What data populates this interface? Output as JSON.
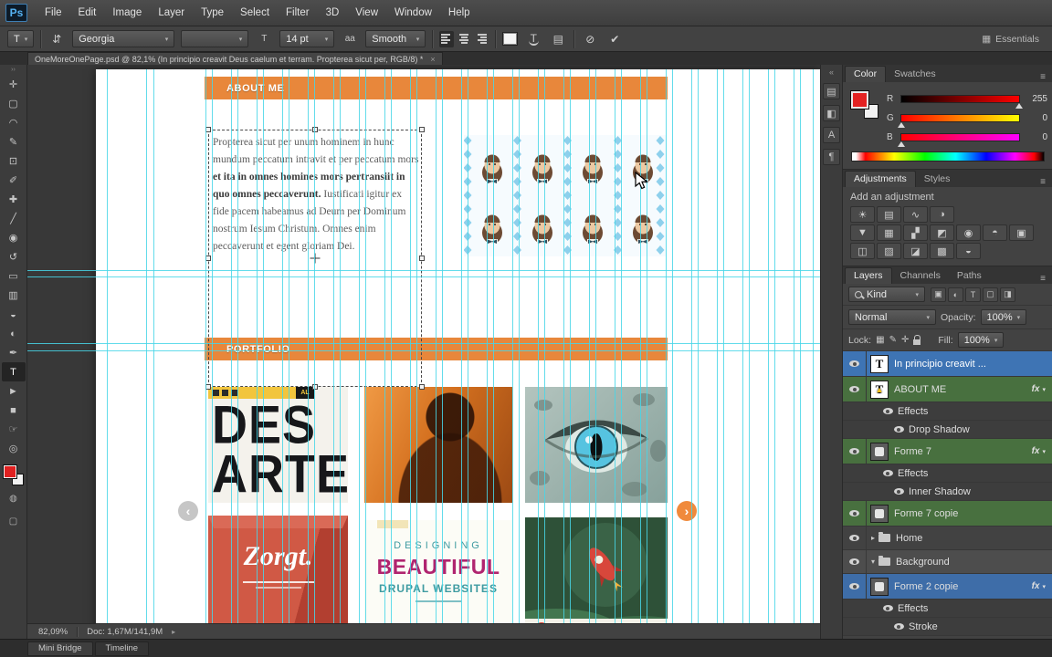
{
  "window": {
    "menubar": {
      "logo": "Ps",
      "items": [
        "File",
        "Edit",
        "Image",
        "Layer",
        "Type",
        "Select",
        "Filter",
        "3D",
        "View",
        "Window",
        "Help"
      ]
    },
    "options_bar": {
      "tool_badge": "T",
      "font_family": "Georgia",
      "font_style": "",
      "font_size": "14 pt",
      "anti_alias": "Smooth",
      "workspace": "Essentials"
    },
    "document_tab": {
      "title": "OneMoreOnePage.psd @ 82,1% (In principio creavit Deus caelum et terram. Propterea sicut per, RGB/8) *",
      "close": "×"
    },
    "status_bar": {
      "zoom": "82,09%",
      "doc_info": "Doc: 1,67M/141,9M",
      "flyout": "▸"
    },
    "bottom_tabs": [
      {
        "label": "Mini Bridge"
      },
      {
        "label": "Timeline"
      }
    ]
  },
  "icons": {
    "dropdown_arrow": "▾",
    "orientation": "⇵",
    "size_glyph": "T",
    "antialias_glyph": "aa",
    "cancel": "⊘",
    "commit": "✔",
    "workspace_grid": "▦",
    "panel_toggle": "▤",
    "panel_menu": "≡",
    "collapse_dock": "«",
    "strip_handle": "››",
    "prev_arrow": "‹",
    "next_arrow": "›"
  },
  "toolbar": {
    "tools": [
      {
        "name": "move-tool",
        "glyph": "✛"
      },
      {
        "name": "rectangular-marquee-tool",
        "glyph": "▢"
      },
      {
        "name": "lasso-tool",
        "glyph": "◠"
      },
      {
        "name": "quick-selection-tool",
        "glyph": "✎"
      },
      {
        "name": "crop-tool",
        "glyph": "⊡"
      },
      {
        "name": "eyedropper-tool",
        "glyph": "✐"
      },
      {
        "name": "healing-brush-tool",
        "glyph": "✚"
      },
      {
        "name": "brush-tool",
        "glyph": "╱"
      },
      {
        "name": "clone-stamp-tool",
        "glyph": "◉"
      },
      {
        "name": "history-brush-tool",
        "glyph": "↺"
      },
      {
        "name": "eraser-tool",
        "glyph": "▭"
      },
      {
        "name": "gradient-tool",
        "glyph": "▥"
      },
      {
        "name": "blur-tool",
        "glyph": "◒"
      },
      {
        "name": "dodge-tool",
        "glyph": "◐"
      },
      {
        "name": "pen-tool",
        "glyph": "✒"
      },
      {
        "name": "type-tool",
        "glyph": "T",
        "active": true
      },
      {
        "name": "path-selection-tool",
        "glyph": "►"
      },
      {
        "name": "rectangle-tool",
        "glyph": "■"
      },
      {
        "name": "hand-tool",
        "glyph": "☞"
      },
      {
        "name": "zoom-tool",
        "glyph": "◎"
      }
    ]
  },
  "canvas": {
    "sections": {
      "about": "ABOUT ME",
      "portfolio": "PORTFOLIO"
    },
    "text_block": {
      "lines": [
        [
          {
            "t": "Propterea sicut per unum hominem in hunc",
            "b": false
          }
        ],
        [
          {
            "t": "mundum peccatum intravit et per peccatum mors",
            "b": false
          }
        ],
        [
          {
            "t": "et ita in omnes homines mors pertransiit in",
            "b": true
          }
        ],
        [
          {
            "t": "quo omnes peccaverunt.",
            "b": true
          },
          {
            "t": " Iustificati igitur ex",
            "b": false
          }
        ],
        [
          {
            "t": "fide pacem habeamus ad Deum per Dominum",
            "b": false
          }
        ],
        [
          {
            "t": "nostrum Iesum Christum. Omnes enim",
            "b": false
          }
        ],
        [
          {
            "t": "peccaverunt et egent gloriam Dei.",
            "b": false
          }
        ]
      ]
    },
    "posters": {
      "des_art": {
        "badge": "AL",
        "line1": "DES",
        "line2": "ARTE"
      },
      "zorgt": {
        "title": "Zorgt."
      },
      "beautiful": {
        "line1": "DESIGNING",
        "line2": "BEAUTIFUL",
        "line3": "DRUPAL WEBSITES"
      }
    },
    "guides": {
      "vertical": [
        117,
        160,
        168,
        225,
        232,
        253,
        260,
        281,
        288,
        309,
        316,
        337,
        344,
        365,
        372,
        393,
        400,
        421,
        428,
        449,
        456,
        477,
        484,
        505,
        512,
        533,
        540,
        561,
        568,
        589,
        596,
        617,
        624,
        645,
        652,
        673,
        680,
        701,
        708,
        729,
        736,
        757,
        764,
        785,
        792,
        813,
        820,
        841,
        848,
        869,
        876,
        890
      ],
      "horizontal": [
        296,
        303,
        376,
        384
      ]
    }
  },
  "panels": {
    "color": {
      "tabs": [
        "Color",
        "Swatches"
      ],
      "sliders": [
        {
          "label": "R",
          "value": "255",
          "pos": 100,
          "from": "#000000",
          "to": "#ff0000"
        },
        {
          "label": "G",
          "value": "0",
          "pos": 0,
          "from": "#ff0000",
          "to": "#ffff00"
        },
        {
          "label": "B",
          "value": "0",
          "pos": 0,
          "from": "#ff0000",
          "to": "#ff00ff"
        }
      ]
    },
    "adjustments": {
      "tabs": [
        "Adjustments",
        "Styles"
      ],
      "title": "Add an adjustment",
      "rows": [
        [
          {
            "name": "brightness-contrast",
            "glyph": "☀"
          },
          {
            "name": "levels",
            "glyph": "▤"
          },
          {
            "name": "curves",
            "glyph": "∿"
          },
          {
            "name": "exposure",
            "glyph": "◑"
          }
        ],
        [
          {
            "name": "vibrance",
            "glyph": "▼"
          },
          {
            "name": "hue-saturation",
            "glyph": "▦"
          },
          {
            "name": "color-balance",
            "glyph": "▞"
          },
          {
            "name": "black-white",
            "glyph": "◩"
          },
          {
            "name": "photo-filter",
            "glyph": "◉"
          },
          {
            "name": "channel-mixer",
            "glyph": "◓"
          },
          {
            "name": "color-lookup",
            "glyph": "▣"
          }
        ],
        [
          {
            "name": "invert",
            "glyph": "◫"
          },
          {
            "name": "posterize",
            "glyph": "▨"
          },
          {
            "name": "threshold",
            "glyph": "◪"
          },
          {
            "name": "gradient-map",
            "glyph": "▩"
          },
          {
            "name": "selective-color",
            "glyph": "◒"
          }
        ]
      ]
    },
    "layers": {
      "tabs": [
        "Layers",
        "Channels",
        "Paths"
      ],
      "filter_label": "Kind",
      "filter_icons": [
        {
          "name": "pixel-layer-filter",
          "glyph": "▣"
        },
        {
          "name": "adjustment-layer-filter",
          "glyph": "◐"
        },
        {
          "name": "type-layer-filter",
          "glyph": "T"
        },
        {
          "name": "shape-layer-filter",
          "glyph": "▢"
        },
        {
          "name": "smart-object-filter",
          "glyph": "◨"
        }
      ],
      "blend_mode": "Normal",
      "opacity_label": "Opacity:",
      "opacity": "100%",
      "lock_label": "Lock:",
      "lock_icons": [
        {
          "name": "lock-transparency",
          "glyph": "▦"
        },
        {
          "name": "lock-pixels",
          "glyph": "✎"
        },
        {
          "name": "lock-position",
          "glyph": "✛"
        },
        {
          "name": "lock-all",
          "glyph": "padlock"
        }
      ],
      "fill_label": "Fill:",
      "fill": "100%",
      "fx_label": "fx",
      "rows": [
        {
          "kind": "layer",
          "thumb": "text",
          "name": "In principio creavit ...",
          "selected": true
        },
        {
          "kind": "layer",
          "thumb": "text",
          "name": "ABOUT ME",
          "color": "green",
          "warning": true,
          "fx": true
        },
        {
          "kind": "fxhead",
          "name": "Effects"
        },
        {
          "kind": "fxitem",
          "name": "Drop Shadow"
        },
        {
          "kind": "layer",
          "thumb": "shape",
          "name": "Forme 7",
          "color": "green",
          "fx": true
        },
        {
          "kind": "fxhead",
          "name": "Effects"
        },
        {
          "kind": "fxitem",
          "name": "Inner Shadow"
        },
        {
          "kind": "layer",
          "thumb": "shape",
          "name": "Forme 7 copie",
          "color": "green"
        },
        {
          "kind": "group",
          "name": "Home",
          "collapsed": true
        },
        {
          "kind": "group",
          "name": "Background",
          "collapsed": false,
          "color": "gray"
        },
        {
          "kind": "layer",
          "thumb": "shape",
          "name": "Forme 2 copie",
          "color": "blue",
          "fx": true
        },
        {
          "kind": "fxhead",
          "name": "Effects"
        },
        {
          "kind": "fxitem",
          "name": "Stroke"
        }
      ]
    }
  },
  "right_dock": {
    "icons": [
      {
        "name": "history-panel-icon",
        "glyph": "▤"
      },
      {
        "name": "properties-panel-icon",
        "glyph": "◧"
      },
      {
        "name": "character-panel-icon",
        "glyph": "A"
      },
      {
        "name": "paragraph-panel-icon",
        "glyph": "¶"
      }
    ]
  }
}
